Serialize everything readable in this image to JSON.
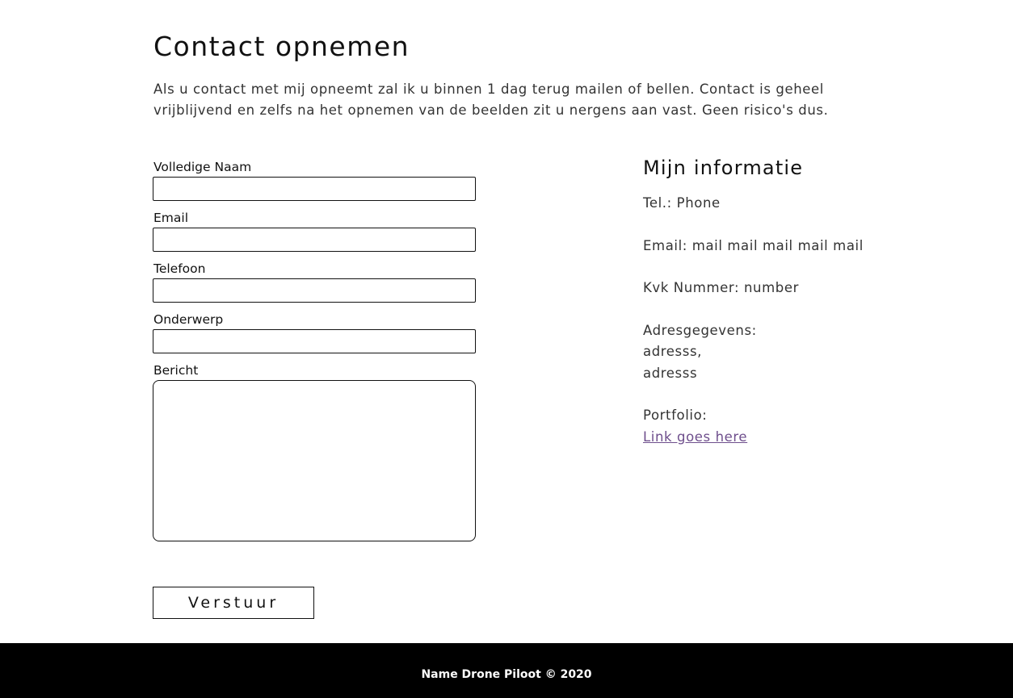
{
  "page": {
    "title": "Contact opnemen",
    "intro_line1": "Als u contact met mij opneemt zal ik u binnen 1 dag terug mailen of bellen. Contact is geheel",
    "intro_line2": "vrijblijvend en zelfs na het opnemen van de beelden zit u nergens aan vast. Geen risico's dus."
  },
  "form": {
    "fields": [
      {
        "label": "Volledige Naam",
        "value": "",
        "placeholder": ""
      },
      {
        "label": "Email",
        "value": "",
        "placeholder": ""
      },
      {
        "label": "Telefoon",
        "value": "",
        "placeholder": ""
      },
      {
        "label": "Onderwerp",
        "value": "",
        "placeholder": ""
      },
      {
        "label": "Bericht",
        "value": "",
        "placeholder": ""
      }
    ],
    "submit_label": "Verstuur"
  },
  "info": {
    "title": "Mijn informatie",
    "phone": "Tel.: Phone",
    "email": "Email: mail mail mail mail mail",
    "kvk": "Kvk Nummer: number",
    "address_label": "Adresgegevens:",
    "address_line1": "adresss,",
    "address_line2": "adresss",
    "portfolio_label": "Portfolio:",
    "portfolio_link": "Link goes here"
  },
  "footer": {
    "text": "Name Drone Piloot © 2020"
  },
  "colors": {
    "link": "#6e4e8c",
    "footer_bg": "#000000",
    "text": "#333333"
  }
}
